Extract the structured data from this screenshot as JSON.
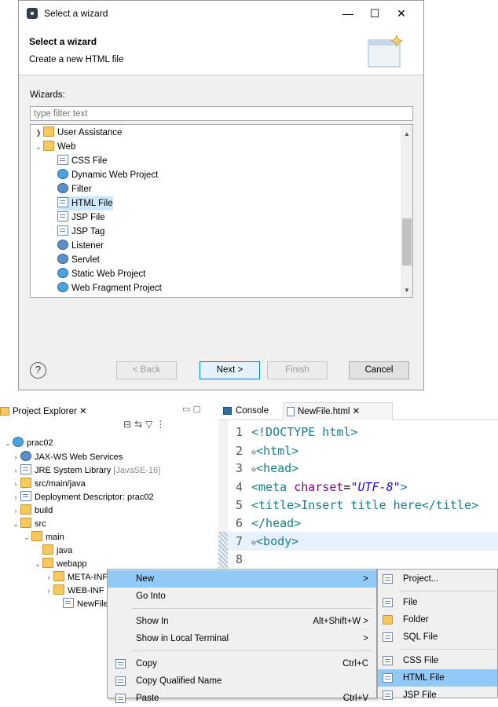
{
  "wizard": {
    "window_title": "Select a wizard",
    "header_title": "Select a wizard",
    "header_desc": "Create a new HTML file",
    "wizards_label": "Wizards:",
    "filter_placeholder": "type filter text",
    "tree": [
      {
        "label": "User Assistance",
        "icon": "folder-icon",
        "expanded": false
      },
      {
        "label": "Web",
        "icon": "folder-icon",
        "expanded": true
      },
      {
        "label": "CSS File",
        "icon": "css-file-icon"
      },
      {
        "label": "Dynamic Web Project",
        "icon": "web-project-icon"
      },
      {
        "label": "Filter",
        "icon": "filter-icon"
      },
      {
        "label": "HTML File",
        "icon": "html-file-icon",
        "selected": true
      },
      {
        "label": "JSP File",
        "icon": "jsp-file-icon"
      },
      {
        "label": "JSP Tag",
        "icon": "jsp-tag-icon"
      },
      {
        "label": "Listener",
        "icon": "listener-icon"
      },
      {
        "label": "Servlet",
        "icon": "servlet-icon"
      },
      {
        "label": "Static Web Project",
        "icon": "static-web-project-icon"
      },
      {
        "label": "Web Fragment Project",
        "icon": "web-fragment-icon"
      }
    ],
    "buttons": {
      "help": "?",
      "back": "< Back",
      "next": "Next >",
      "finish": "Finish",
      "cancel": "Cancel"
    }
  },
  "explorer": {
    "tab": "Project Explorer",
    "project": "prac02",
    "items": [
      {
        "label": "JAX-WS Web Services",
        "suffix": ""
      },
      {
        "label": "JRE System Library",
        "suffix": "[JavaSE-16]"
      },
      {
        "label": "src/main/java",
        "suffix": ""
      },
      {
        "label": "Deployment Descriptor: prac02",
        "suffix": ""
      },
      {
        "label": "build",
        "suffix": ""
      },
      {
        "label": "src",
        "suffix": ""
      },
      {
        "label": "main",
        "suffix": ""
      },
      {
        "label": "java",
        "suffix": ""
      },
      {
        "label": "webapp",
        "suffix": ""
      },
      {
        "label": "META-INF",
        "suffix": ""
      },
      {
        "label": "WEB-INF",
        "suffix": ""
      },
      {
        "label": "NewFile.html",
        "suffix": ""
      }
    ]
  },
  "editor": {
    "tabs": [
      "Console",
      "NewFile.html"
    ],
    "lines": [
      {
        "n": "1",
        "text": "<!DOCTYPE html>"
      },
      {
        "n": "2",
        "text": "<html>"
      },
      {
        "n": "3",
        "text": "<head>"
      },
      {
        "n": "4",
        "tag": "<meta ",
        "attr": "charset",
        "eq": "=",
        "str": "\"UTF-8\"",
        "end": ">"
      },
      {
        "n": "5",
        "text": "<title>Insert title here</title>"
      },
      {
        "n": "6",
        "text": "</head>"
      },
      {
        "n": "7",
        "text": "<body>"
      },
      {
        "n": "8",
        "text": ""
      }
    ]
  },
  "context_menu": [
    {
      "label": "New",
      "accel": ">",
      "highlight": true
    },
    {
      "label": "Go Into",
      "accel": ""
    },
    {
      "label": "Show In",
      "accel": "Alt+Shift+W >"
    },
    {
      "label": "Show in Local Terminal",
      "accel": ">"
    },
    {
      "label": "Copy",
      "accel": "Ctrl+C"
    },
    {
      "label": "Copy Qualified Name",
      "accel": ""
    },
    {
      "label": "Paste",
      "accel": "Ctrl+V"
    }
  ],
  "submenu": [
    {
      "label": "Project..."
    },
    {
      "label": "File"
    },
    {
      "label": "Folder"
    },
    {
      "label": "SQL File"
    },
    {
      "label": "CSS File"
    },
    {
      "label": "HTML File",
      "highlight": true
    },
    {
      "label": "JSP File"
    }
  ]
}
